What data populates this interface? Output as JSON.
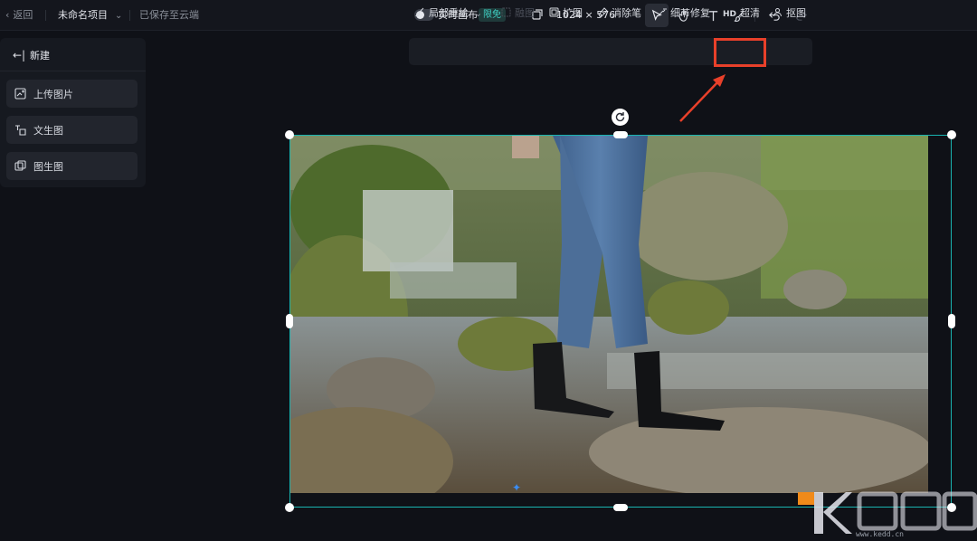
{
  "header": {
    "back_label": "返回",
    "project_name": "未命名项目",
    "save_status": "已保存至云端",
    "realtime_label": "实时画布",
    "free_badge": "限免",
    "canvas_size": "1024 × 576"
  },
  "sidebar": {
    "new_label": "新建",
    "items": [
      {
        "label": "上传图片"
      },
      {
        "label": "文生图"
      },
      {
        "label": "图生图"
      }
    ]
  },
  "subtoolbar": {
    "items": [
      {
        "label": "局部重绘"
      },
      {
        "label": "融图"
      },
      {
        "label": "扩图"
      },
      {
        "label": "消除笔"
      },
      {
        "label": "细节修复"
      },
      {
        "label": "超清",
        "prefix": "HD"
      },
      {
        "label": "抠图"
      }
    ]
  },
  "watermark": {
    "text": "www.kedd.cn"
  },
  "colors": {
    "accent": "#19b3b0",
    "highlight": "#e8402a",
    "badge_text": "#3fd1c4"
  }
}
